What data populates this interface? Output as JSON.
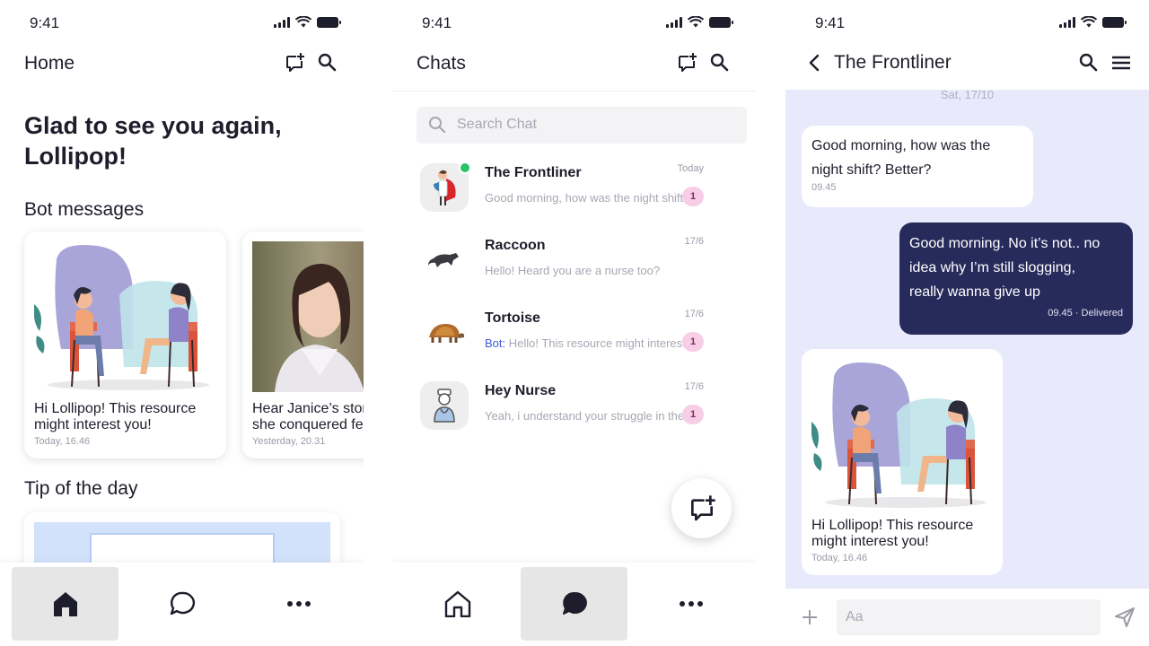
{
  "status": {
    "time": "9:41"
  },
  "home": {
    "title": "Home",
    "greeting": "Glad to see you again, Lollipop!",
    "bot_messages_heading": "Bot messages",
    "cards": [
      {
        "text": "Hi Lollipop! This resource\nmight interest you!",
        "date": "Today, 16.46"
      },
      {
        "text": "Hear Janice’s stor\nshe conquered fe",
        "date": "Yesterday, 20.31"
      }
    ],
    "tip_heading": "Tip of the day"
  },
  "chats": {
    "title": "Chats",
    "search_placeholder": "Search Chat",
    "items": [
      {
        "name": "The Frontliner",
        "date": "Today",
        "preview": "Good morning, how was the night shift? Better?",
        "bot_prefix": "",
        "unread": "1",
        "avatar": "frontliner-avatar"
      },
      {
        "name": "Raccoon",
        "date": "17/6",
        "preview": "Hello! Heard you are a nurse too?",
        "bot_prefix": "",
        "unread": "",
        "avatar": "raccoon-avatar"
      },
      {
        "name": "Tortoise",
        "date": "17/6",
        "preview": "Hello! This resource might interest you!",
        "bot_prefix": "Bot: ",
        "unread": "1",
        "avatar": "tortoise-avatar"
      },
      {
        "name": "Hey Nurse",
        "date": "17/6",
        "preview": "Yeah, i understand your struggle in the ward",
        "bot_prefix": "",
        "unread": "1",
        "avatar": "nurse-avatar"
      }
    ]
  },
  "conversation": {
    "title": "The Frontliner",
    "date_divider": "Sat, 17/10",
    "messages": [
      {
        "direction": "in",
        "text": "Good morning, how was the\nnight shift? Better?",
        "meta": "09.45"
      },
      {
        "direction": "out",
        "text": "Good morning. No it’s not.. no\nidea why I’m still slogging,\nreally wanna give up",
        "meta": "09.45 · Delivered"
      },
      {
        "direction": "in",
        "text": "Hi Lollipop! This resource\nmight interest you!",
        "meta": "Today, 16.46"
      }
    ],
    "composer_placeholder": "Aa"
  },
  "colors": {
    "accent_dark": "#272b5b",
    "chat_background": "#e8e9fb",
    "online": "#27c46b",
    "unread_badge": "#f8cde6",
    "bot_label": "#3f5bd6"
  }
}
